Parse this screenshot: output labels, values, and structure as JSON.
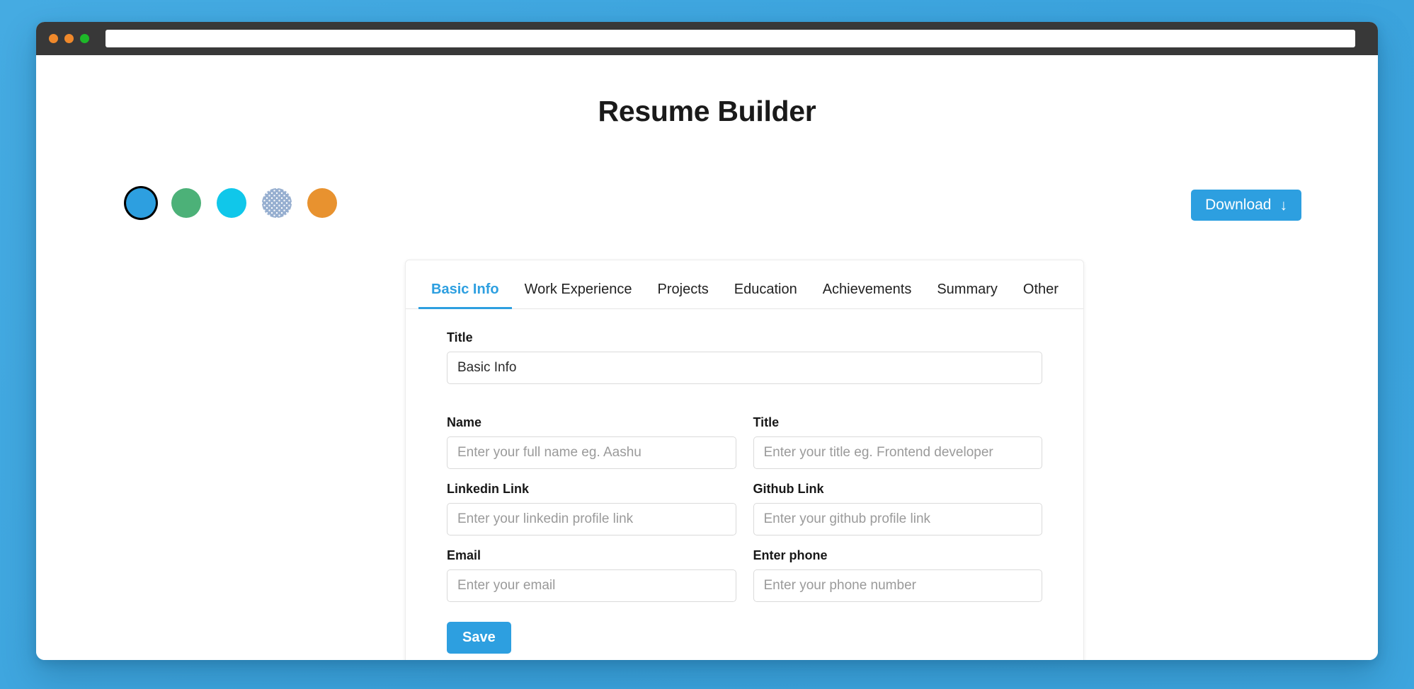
{
  "browser": {
    "traffic_lights": [
      {
        "name": "close",
        "color": "#f0892b"
      },
      {
        "name": "minimize",
        "color": "#f0892b"
      },
      {
        "name": "maximize",
        "color": "#1db828"
      }
    ],
    "url_value": "",
    "url_placeholder": ""
  },
  "header": {
    "title": "Resume Builder"
  },
  "themes": {
    "swatches": [
      {
        "name": "blue",
        "color": "#2d9fe0",
        "selected": true,
        "pattern": "solid"
      },
      {
        "name": "green",
        "color": "#4cb178",
        "selected": false,
        "pattern": "solid"
      },
      {
        "name": "cyan",
        "color": "#10c7ea",
        "selected": false,
        "pattern": "solid"
      },
      {
        "name": "gray",
        "color": "#97afd0",
        "selected": false,
        "pattern": "dotted"
      },
      {
        "name": "orange",
        "color": "#e8922f",
        "selected": false,
        "pattern": "solid"
      }
    ]
  },
  "actions": {
    "download_label": "Download",
    "download_icon": "arrow-down-icon",
    "download_arrow": "↓",
    "accent_color": "#2d9fe0"
  },
  "tabs": [
    {
      "label": "Basic Info",
      "active": true
    },
    {
      "label": "Work Experience",
      "active": false
    },
    {
      "label": "Projects",
      "active": false
    },
    {
      "label": "Education",
      "active": false
    },
    {
      "label": "Achievements",
      "active": false
    },
    {
      "label": "Summary",
      "active": false
    },
    {
      "label": "Other",
      "active": false
    }
  ],
  "form": {
    "section_title": {
      "label": "Title",
      "value": "Basic Info",
      "placeholder": ""
    },
    "fields": [
      {
        "label": "Name",
        "value": "",
        "placeholder": "Enter your full name eg. Aashu"
      },
      {
        "label": "Title",
        "value": "",
        "placeholder": "Enter your title eg. Frontend developer"
      },
      {
        "label": "Linkedin Link",
        "value": "",
        "placeholder": "Enter your linkedin profile link"
      },
      {
        "label": "Github Link",
        "value": "",
        "placeholder": "Enter your github profile link"
      },
      {
        "label": "Email",
        "value": "",
        "placeholder": "Enter your email"
      },
      {
        "label": "Enter phone",
        "value": "",
        "placeholder": "Enter your phone number"
      }
    ],
    "save_label": "Save"
  }
}
